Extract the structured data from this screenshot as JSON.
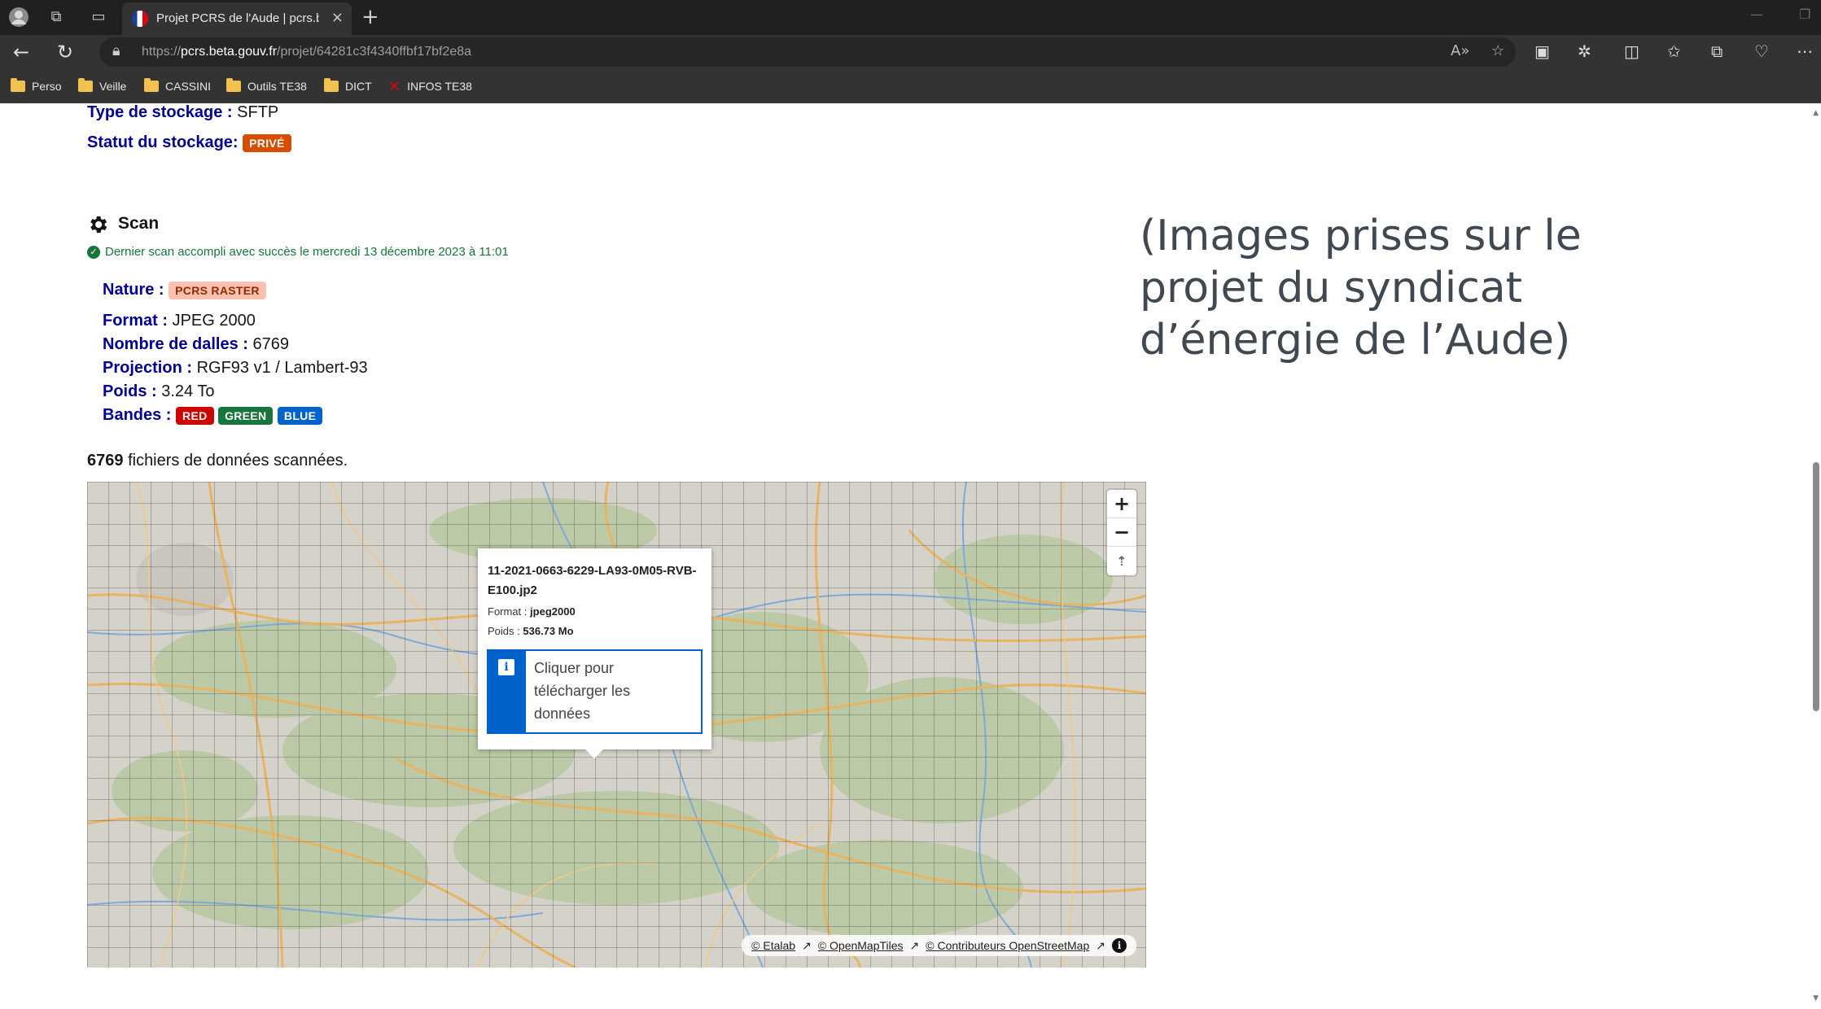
{
  "browser": {
    "tab_title": "Projet PCRS de l'Aude | pcrs.beta",
    "url_prefix": "https://",
    "url_host": "pcrs.beta.gouv.fr",
    "url_path": "/projet/64281c3f4340ffbf17bf2e8a",
    "bookmarks": [
      {
        "label": "Perso",
        "icon": "folder-icon"
      },
      {
        "label": "Veille",
        "icon": "folder-icon"
      },
      {
        "label": "CASSINI",
        "icon": "folder-icon"
      },
      {
        "label": "Outils TE38",
        "icon": "folder-icon"
      },
      {
        "label": "DICT",
        "icon": "folder-icon"
      },
      {
        "label": "INFOS TE38",
        "icon": "x-icon"
      }
    ]
  },
  "storage": {
    "type_label": "Type de stockage :",
    "type_value": "SFTP",
    "status_label": "Statut du stockage:",
    "status_badge": "PRIVÉ"
  },
  "scan": {
    "title": "Scan",
    "last_scan": "Dernier scan accompli avec succès le mercredi 13 décembre 2023 à 11:01",
    "nature_label": "Nature :",
    "nature_badge": "PCRS RASTER",
    "format_label": "Format :",
    "format_value": "JPEG 2000",
    "dalles_label": "Nombre de dalles :",
    "dalles_value": "6769",
    "projection_label": "Projection :",
    "projection_value": "RGF93 v1 / Lambert-93",
    "poids_label": "Poids :",
    "poids_value": "3.24 To",
    "bandes_label": "Bandes :",
    "bandes": [
      "RED",
      "GREEN",
      "BLUE"
    ],
    "files_count": "6769",
    "files_text": "fichiers de données scannées."
  },
  "note": "(Images prises sur le projet du syndicat d’énergie de l’Aude)",
  "map": {
    "zoom_in": "+",
    "zoom_out": "−",
    "compass": "⇡",
    "attribution": [
      "© Etalab",
      "© OpenMapTiles",
      "© Contributeurs OpenStreetMap"
    ],
    "popup": {
      "file_name": "11-2021-0663-6229-LA93-0M05-RVB-E100.jp2",
      "format_label": "Format :",
      "format_value": "jpeg2000",
      "poids_label": "Poids :",
      "poids_value": "536.73 Mo",
      "download_text": "Cliquer pour télécharger les données"
    }
  }
}
